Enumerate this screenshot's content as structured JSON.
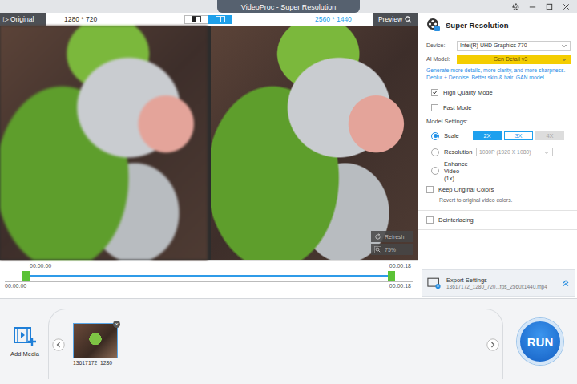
{
  "window": {
    "title": "VideoProc - Super Resolution"
  },
  "preview": {
    "play_glyph": "▷",
    "original_label": "Original",
    "source_resolution": "1280 * 720",
    "output_resolution": "2560 * 1440",
    "preview_label": "Preview",
    "view_modes": [
      {
        "kind": "split",
        "selected": false
      },
      {
        "kind": "side-by-side",
        "selected": true
      }
    ],
    "refresh_label": "Refresh",
    "zoom": "75%"
  },
  "timeline": {
    "range_start": "00:00:00",
    "range_end": "00:00:18",
    "start": "00:00:00",
    "end": "00:00:18",
    "level": 1
  },
  "settings": {
    "title": "Super Resolution",
    "device_label": "Device:",
    "device": "Intel(R) UHD Graphics 770",
    "model_label": "AI Model:",
    "model": "Gen Detail v3",
    "description": "Generate more details, more clarity, and more sharpness. Deblur + Denoise. Better skin & hair. GAN model.",
    "options": [
      {
        "label": "High Quality Mode",
        "checked": true
      },
      {
        "label": "Fast Mode",
        "checked": false
      }
    ],
    "model_settings_label": "Model Settings:",
    "modes": [
      {
        "kind": "scale",
        "label": "Scale",
        "selected": true,
        "scales": [
          {
            "label": "2X",
            "selected": true,
            "disabled": false
          },
          {
            "label": "3X",
            "selected": false,
            "disabled": false
          },
          {
            "label": "4X",
            "selected": false,
            "disabled": true
          }
        ]
      },
      {
        "kind": "resolution",
        "label": "Resolution",
        "selected": false,
        "value": "1080P (1920 X 1080)",
        "disabled": true
      },
      {
        "kind": "plain",
        "label": "Enhance Video (1x)",
        "selected": false
      }
    ],
    "keep_colors": {
      "label": "Keep Original Colors",
      "checked": false,
      "hint": "Revert to original video colors."
    },
    "deinterlacing": {
      "label": "Deinterlacing",
      "checked": false
    },
    "export": {
      "title": "Export Settings",
      "file": "13617172_1280_720...fps_2560x1440.mp4"
    }
  },
  "media": {
    "add_label": "Add Media",
    "items": [
      {
        "name": "13617172_1280_",
        "selected": true,
        "remove_glyph": "×"
      }
    ],
    "run_label": "RUN"
  }
}
